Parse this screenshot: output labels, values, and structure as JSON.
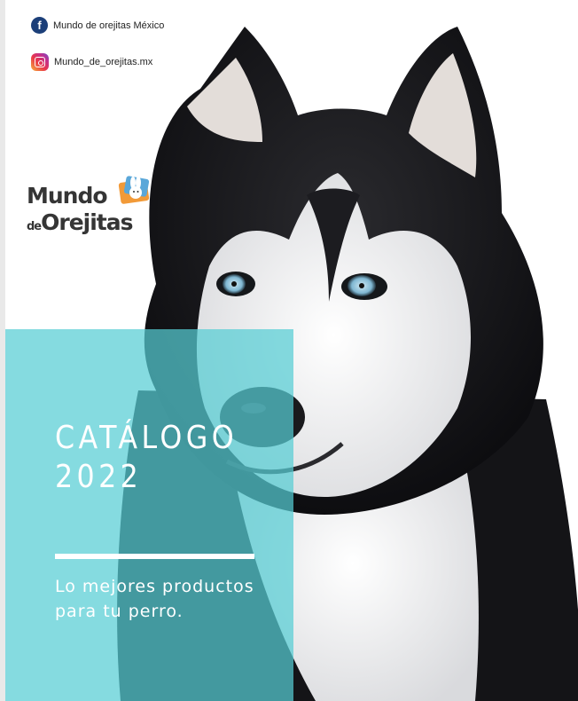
{
  "social": {
    "facebook": {
      "icon": "facebook-icon",
      "label": "Mundo de orejitas México",
      "color": "#1c3f79"
    },
    "instagram": {
      "icon": "instagram-icon",
      "label": "Mundo_de_orejitas.mx"
    }
  },
  "logo": {
    "line1": "Mundo",
    "line2_prefix": "de",
    "line2_main": "Orejitas"
  },
  "cover": {
    "title": "CATÁLOGO\n2022",
    "subtitle": "Lo mejores productos para tu perro."
  },
  "colors": {
    "panel": "#56cdd4",
    "text": "#ffffff",
    "logo_text": "#353535"
  }
}
